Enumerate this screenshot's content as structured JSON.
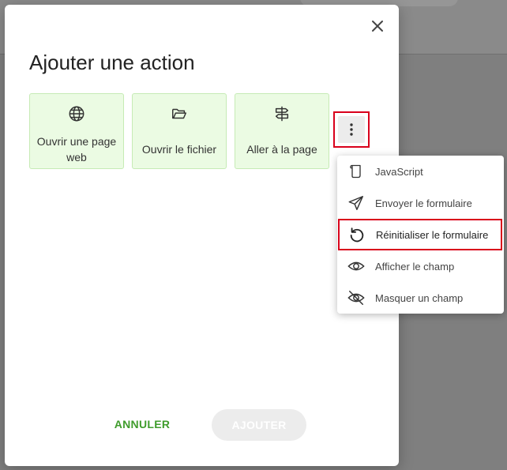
{
  "dialog": {
    "title": "Ajouter une action",
    "close_icon": "close-icon",
    "action_cards": [
      {
        "label": "Ouvrir une page web",
        "icon": "globe-icon"
      },
      {
        "label": "Ouvrir le fichier",
        "icon": "folder-open-icon"
      },
      {
        "label": "Aller à la page",
        "icon": "signpost-icon"
      }
    ],
    "more_icon": "more-vertical-icon",
    "cancel_label": "ANNULER",
    "add_label": "AJOUTER"
  },
  "menu": {
    "items": [
      {
        "label": "JavaScript",
        "icon": "script-icon"
      },
      {
        "label": "Envoyer le formulaire",
        "icon": "send-icon"
      },
      {
        "label": "Réinitialiser le formulaire",
        "icon": "reset-icon",
        "highlighted": true
      },
      {
        "label": "Afficher le champ",
        "icon": "eye-icon"
      },
      {
        "label": "Masquer un champ",
        "icon": "eye-off-icon"
      }
    ]
  },
  "colors": {
    "accent_green": "#3f9c2c",
    "card_bg": "#ebfbe3",
    "highlight_red": "#d9001b",
    "disabled_bg": "#ececec"
  }
}
